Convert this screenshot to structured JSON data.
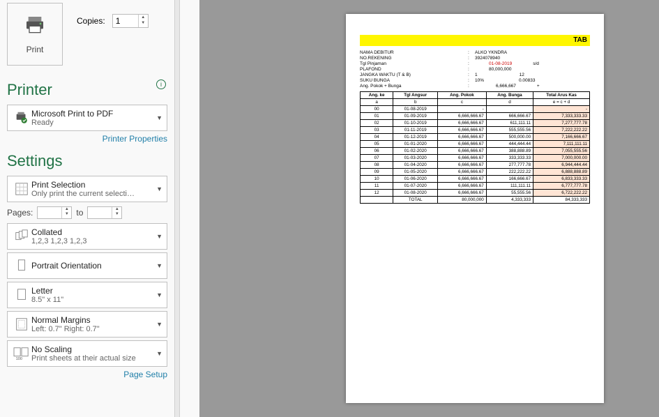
{
  "print": {
    "label": "Print"
  },
  "copies": {
    "label": "Copies:",
    "value": "1"
  },
  "printer_section": "Printer",
  "printer": {
    "name": "Microsoft Print to PDF",
    "status": "Ready"
  },
  "printer_properties": "Printer Properties",
  "settings_section": "Settings",
  "print_what": {
    "title": "Print Selection",
    "sub": "Only print the current selecti…"
  },
  "pages": {
    "label": "Pages:",
    "from": "",
    "to_label": "to",
    "to": ""
  },
  "collate": {
    "title": "Collated",
    "sub": "1,2,3    1,2,3    1,2,3"
  },
  "orient": {
    "title": "Portrait Orientation"
  },
  "paper": {
    "title": "Letter",
    "sub": "8.5\" x 11\""
  },
  "margins": {
    "title": "Normal Margins",
    "sub": "Left:  0.7\"    Right:  0.7\""
  },
  "scaling": {
    "title": "No Scaling",
    "sub": "Print sheets at their actual size"
  },
  "page_setup": "Page Setup",
  "preview": {
    "heading": "TAB",
    "meta": {
      "nama_label": "NAMA DEBITUR",
      "nama_val": "ALKO YKNDRA",
      "rek_label": "NO.REKENING",
      "rek_val": "3924078940",
      "tgl_label": "Tgl Pinjaman",
      "tgl_val": "01-08-2019",
      "tgl_extra": "s/d",
      "plaf_label": "PLAFOND",
      "plaf_val": "80,000,000",
      "jangka_label": "JANGKA WAKTU (T & B)",
      "jangka_val": "1",
      "jangka_val2": "12",
      "bunga_label": "SUKU BUNGA",
      "bunga_val": "10%",
      "bunga_val2": "0.00833",
      "ang_label": "Ang. Pokok + Bunga",
      "ang_val": "6,666,667",
      "ang_val2": "+"
    },
    "cols": [
      "Ang. ke",
      "Tgl Angsur",
      "Ang. Pokok",
      "Ang. Bunga",
      "Total Arus Kas"
    ],
    "subcols": [
      "a",
      "b",
      "c",
      "d",
      "e = c + d"
    ],
    "rows": [
      [
        "00",
        "01-08-2019",
        "-",
        "",
        "-"
      ],
      [
        "01",
        "01-09-2019",
        "6,666,666.67",
        "666,666.67",
        "7,333,333.33"
      ],
      [
        "02",
        "01-10-2019",
        "6,666,666.67",
        "611,111.11",
        "7,277,777.78"
      ],
      [
        "03",
        "01-11-2019",
        "6,666,666.67",
        "555,555.56",
        "7,222,222.22"
      ],
      [
        "04",
        "01-12-2019",
        "6,666,666.67",
        "500,000.00",
        "7,166,666.67"
      ],
      [
        "05",
        "01-01-2020",
        "6,666,666.67",
        "444,444.44",
        "7,111,111.11"
      ],
      [
        "06",
        "01-02-2020",
        "6,666,666.67",
        "388,888.89",
        "7,055,555.56"
      ],
      [
        "07",
        "01-03-2020",
        "6,666,666.67",
        "333,333.33",
        "7,000,000.00"
      ],
      [
        "08",
        "01-04-2020",
        "6,666,666.67",
        "277,777.78",
        "6,944,444.44"
      ],
      [
        "09",
        "01-05-2020",
        "6,666,666.67",
        "222,222.22",
        "6,888,888.89"
      ],
      [
        "10",
        "01-06-2020",
        "6,666,666.67",
        "166,666.67",
        "6,833,333.33"
      ],
      [
        "11",
        "01-07-2020",
        "6,666,666.67",
        "111,111.11",
        "6,777,777.78"
      ],
      [
        "12",
        "01-08-2020",
        "6,666,666.67",
        "55,555.56",
        "6,722,222.22"
      ]
    ],
    "total_row": [
      "",
      "TOTAL",
      "80,000,000",
      "4,333,333",
      "84,333,333"
    ]
  }
}
